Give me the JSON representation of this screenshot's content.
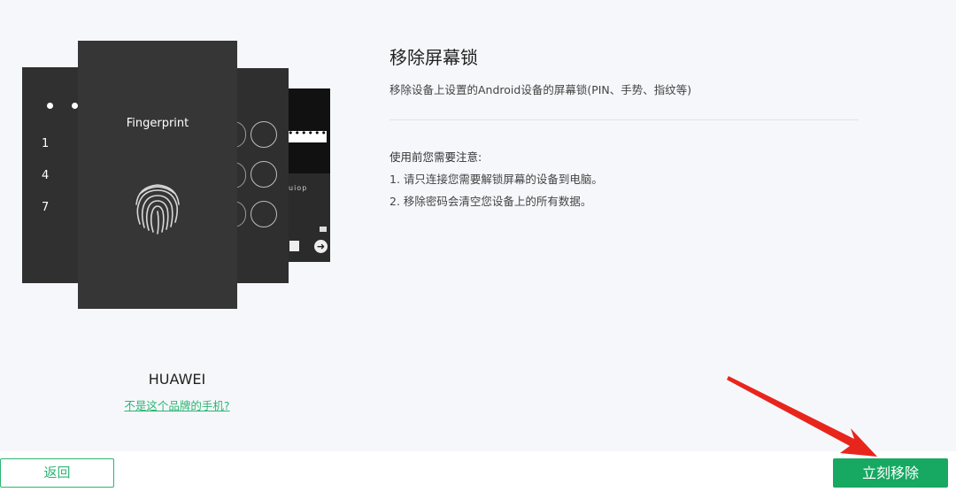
{
  "illustration": {
    "fingerprint_label": "Fingerprint",
    "keypad_digits": [
      "1",
      "4",
      "7"
    ],
    "pin_dots": "••••••",
    "keyboard_row": "uiop",
    "arrow_glyph": "➜"
  },
  "device": {
    "brand": "HUAWEI",
    "wrong_brand_link": "不是这个品牌的手机?"
  },
  "content": {
    "title": "移除屏幕锁",
    "subtitle": "移除设备上设置的Android设备的屏幕锁(PIN、手势、指纹等)",
    "notice_heading": "使用前您需要注意:",
    "notices": [
      "1. 请只连接您需要解锁屏幕的设备到电脑。",
      "2. 移除密码会清空您设备上的所有数据。"
    ]
  },
  "footer": {
    "back_label": "返回",
    "remove_label": "立刻移除"
  },
  "colors": {
    "accent": "#17a862",
    "link": "#2bb673",
    "annotation_arrow": "#e8251c",
    "background": "#f6f7fb"
  },
  "icons": [
    "fingerprint-icon",
    "arrow-right-icon",
    "backspace-icon"
  ]
}
